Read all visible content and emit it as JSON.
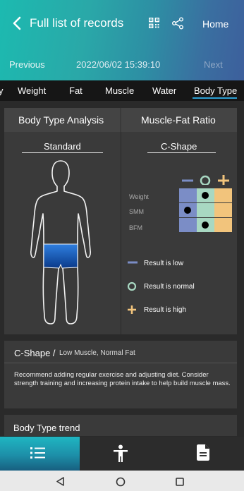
{
  "header": {
    "title": "Full list of records",
    "home_label": "Home",
    "previous_label": "Previous",
    "datetime": "2022/06/02 15:39:10",
    "next_label": "Next"
  },
  "tabs": [
    {
      "label": "y"
    },
    {
      "label": "Weight"
    },
    {
      "label": "Fat"
    },
    {
      "label": "Muscle"
    },
    {
      "label": "Water"
    },
    {
      "label": "Body Type",
      "selected": true
    }
  ],
  "analysis": {
    "left_title": "Body Type Analysis",
    "right_title": "Muscle-Fat Ratio",
    "left_sub": "Standard",
    "right_sub": "C-Shape",
    "row_labels": [
      "Weight",
      "SMM",
      "BFM"
    ],
    "column_symbols": [
      "−",
      "○",
      "+"
    ],
    "dots": {
      "Weight": "normal",
      "SMM": "low",
      "BFM": "normal"
    },
    "legend": [
      {
        "symbol": "minus",
        "text": "Result is low"
      },
      {
        "symbol": "circle",
        "text": "Result is normal"
      },
      {
        "symbol": "plus",
        "text": "Result is high"
      }
    ],
    "colors": {
      "low": "#7b8dc6",
      "normal": "#a8d8c2",
      "high": "#f2c47c"
    }
  },
  "result": {
    "shape": "C-Shape /",
    "subtitle": "Low Muscle, Normal Fat",
    "recommendation": "Recommend adding regular exercise and adjusting diet. Consider strength training and increasing protein intake to help build muscle mass."
  },
  "trend": {
    "title": "Body Type trend"
  },
  "bottom_nav": [
    {
      "icon": "list-icon",
      "active": true
    },
    {
      "icon": "person-icon",
      "active": false
    },
    {
      "icon": "document-icon",
      "active": false
    }
  ]
}
